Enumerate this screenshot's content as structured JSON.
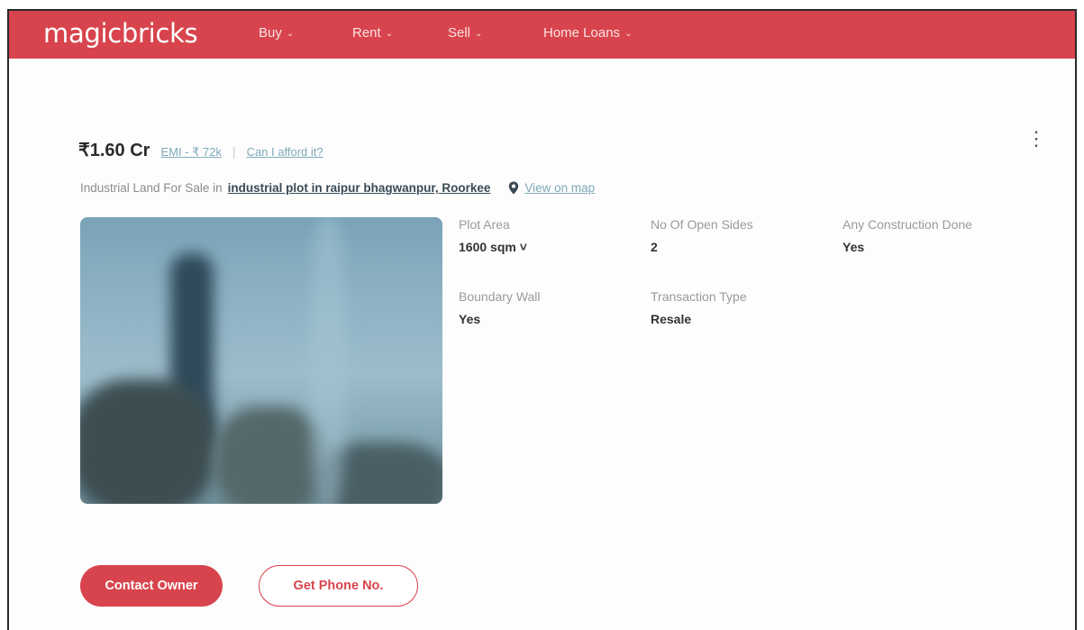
{
  "header": {
    "logo": "magicbricks",
    "nav": [
      {
        "label": "Buy"
      },
      {
        "label": "Rent"
      },
      {
        "label": "Sell"
      },
      {
        "label": "Home Loans"
      }
    ]
  },
  "listing": {
    "price": "₹1.60 Cr",
    "emi": "EMI - ₹ 72k",
    "separator": "|",
    "afford": "Can I afford it?",
    "title_prefix": "Industrial Land For Sale in",
    "title_link": "industrial plot in raipur bhagwanpur, Roorkee",
    "map_link": "View on map",
    "attributes": [
      {
        "label": "Plot Area",
        "value": "1600 sqm ˅"
      },
      {
        "label": "No Of Open Sides",
        "value": "2"
      },
      {
        "label": "Any Construction Done",
        "value": "Yes"
      },
      {
        "label": "Boundary Wall",
        "value": "Yes"
      },
      {
        "label": "Transaction Type",
        "value": "Resale"
      }
    ]
  },
  "actions": {
    "contact_owner": "Contact Owner",
    "get_phone": "Get Phone No."
  },
  "colors": {
    "brand": "#d8444d",
    "link": "#7fa9b8"
  }
}
